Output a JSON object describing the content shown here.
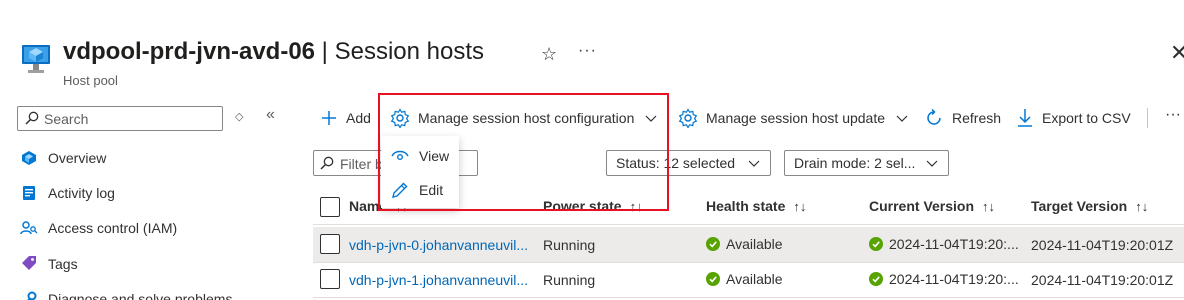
{
  "header": {
    "resource_name": "vdpool-prd-jvn-avd-06",
    "separator": " | ",
    "page_name": "Session hosts",
    "subtitle": "Host pool",
    "star_glyph": "☆",
    "more_glyph": "···",
    "close_glyph": "✕"
  },
  "sidebar": {
    "search_placeholder": "Search",
    "collapse_glyph": "«",
    "diamond_glyph": "◇",
    "items": [
      {
        "label": "Overview",
        "icon": "overview-icon"
      },
      {
        "label": "Activity log",
        "icon": "activity-log-icon"
      },
      {
        "label": "Access control (IAM)",
        "icon": "access-control-icon"
      },
      {
        "label": "Tags",
        "icon": "tag-icon"
      },
      {
        "label": "Diagnose and solve problems",
        "icon": "wrench-icon"
      }
    ]
  },
  "toolbar": {
    "add": "Add",
    "manage_config": "Manage session host configuration",
    "manage_update": "Manage session host update",
    "refresh": "Refresh",
    "export": "Export to CSV",
    "more_glyph": "···"
  },
  "filters": {
    "search_placeholder": "Filter by name...",
    "status": "Status: 12 selected",
    "drain": "Drain mode: 2 sel..."
  },
  "dropdown_menu": {
    "items": [
      {
        "label": "View",
        "icon": "eye-icon"
      },
      {
        "label": "Edit",
        "icon": "pencil-icon"
      }
    ]
  },
  "table": {
    "columns": [
      {
        "label": "Name",
        "sort": "↑↓"
      },
      {
        "label": "Power state",
        "sort": "↑↓"
      },
      {
        "label": "Health state",
        "sort": "↑↓"
      },
      {
        "label": "Current Version",
        "sort": "↑↓"
      },
      {
        "label": "Target Version",
        "sort": "↑↓"
      }
    ],
    "rows": [
      {
        "name": "vdh-p-jvn-0.johanvanneuvil...",
        "power": "Running",
        "health": "Available",
        "current": "2024-11-04T19:20:...",
        "target": "2024-11-04T19:20:01Z",
        "selected": true
      },
      {
        "name": "vdh-p-jvn-1.johanvanneuvil...",
        "power": "Running",
        "health": "Available",
        "current": "2024-11-04T19:20:...",
        "target": "2024-11-04T19:20:01Z",
        "selected": false
      }
    ]
  },
  "colors": {
    "accent": "#0078d4",
    "link": "#0067b8",
    "available": "#57a300",
    "highlight": "#e81123"
  }
}
